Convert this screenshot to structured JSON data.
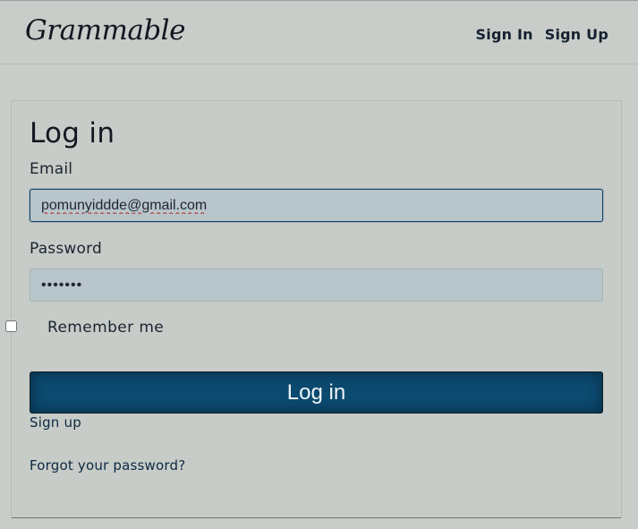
{
  "app": {
    "brand": "Grammable"
  },
  "nav": {
    "sign_in": "Sign In",
    "sign_up": "Sign Up"
  },
  "login_form": {
    "title": "Log in",
    "email_label": "Email",
    "email_value": "pomunyiddde@gmail.com",
    "password_label": "Password",
    "password_value": "•••••••",
    "remember_label": "Remember me",
    "remember_checked": false,
    "submit_label": "Log in",
    "signup_link": "Sign up",
    "forgot_link": "Forgot your password?"
  },
  "colors": {
    "page_background": "#c9cdc9",
    "input_background": "#b8c5ca",
    "primary_button": "#0c4a70",
    "focused_border": "#113f6a"
  }
}
